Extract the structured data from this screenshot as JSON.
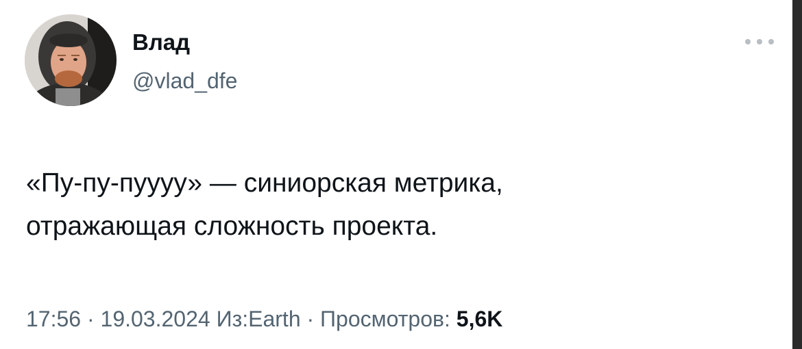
{
  "author": {
    "display_name": "Влад",
    "handle": "@vlad_dfe"
  },
  "tweet": {
    "text_line_1": "«Пу-пу-пуууу» — синиорская метрика,",
    "text_line_2": "отражающая сложность проекта."
  },
  "meta": {
    "time": "17:56",
    "separator_1": " · ",
    "date": "19.03.2024",
    "source_prefix": " Из:",
    "source": "Earth",
    "separator_2": " · ",
    "views_label": "Просмотров: ",
    "views_count": "5,6K"
  },
  "icons": {
    "more": "more-horizontal-icon",
    "avatar": "user-avatar"
  },
  "colors": {
    "primary_text": "#0f1419",
    "secondary_text": "#536471",
    "background": "#ffffff"
  }
}
